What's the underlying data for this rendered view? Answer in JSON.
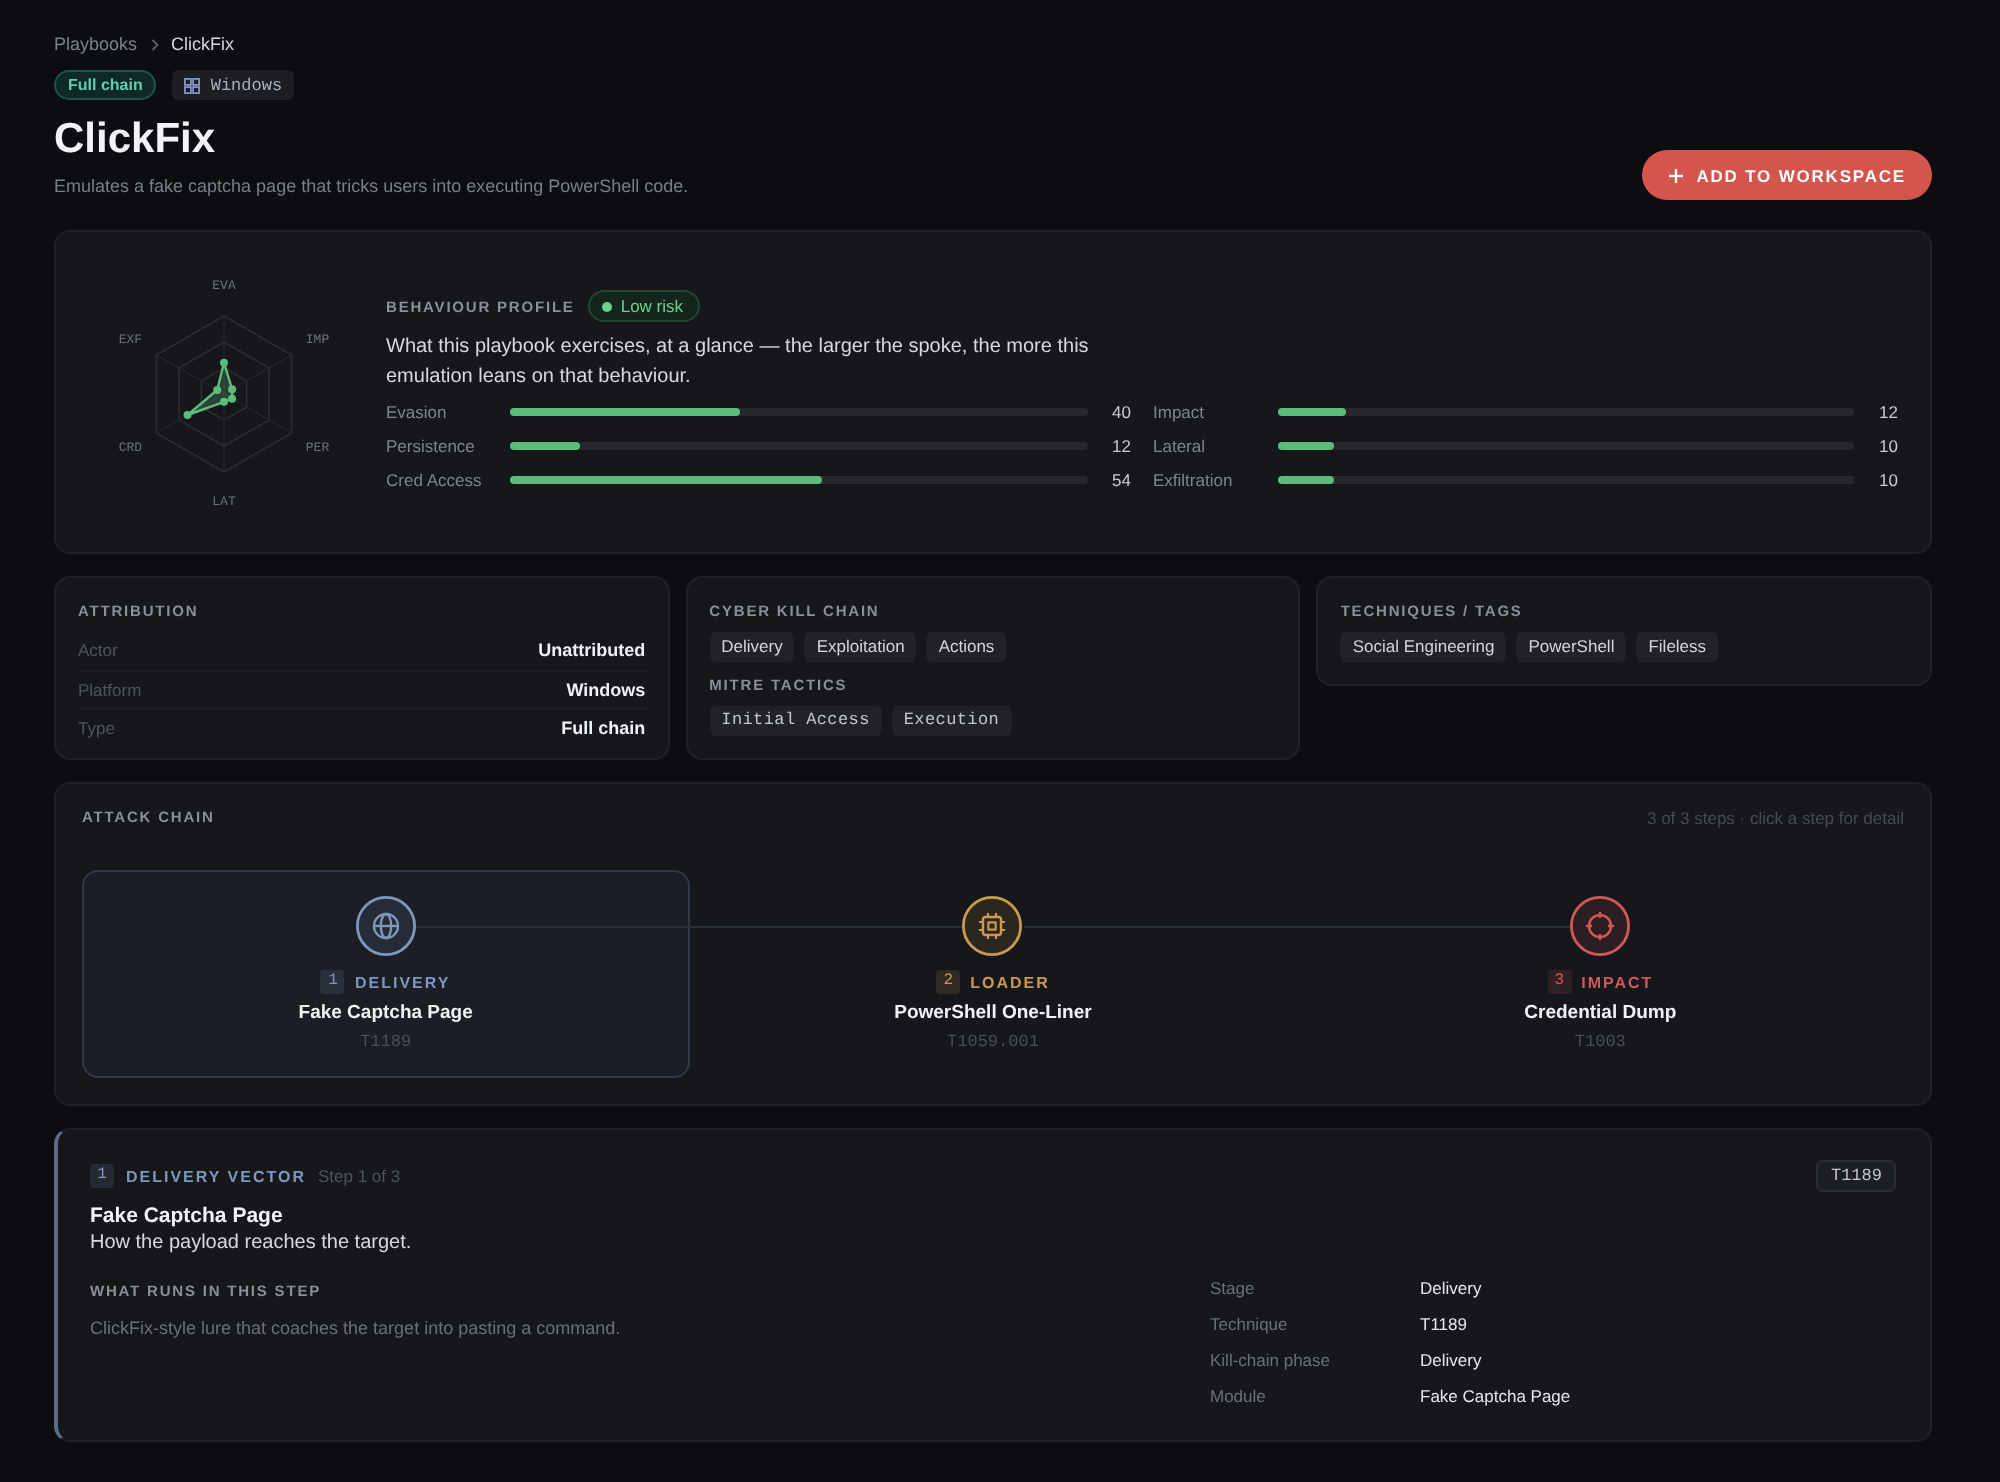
{
  "breadcrumb": [
    {
      "label": "Playbooks",
      "current": false
    },
    {
      "label": "ClickFix",
      "current": true
    }
  ],
  "tags": [
    {
      "label": "Full chain",
      "kind": "chain"
    },
    {
      "label": "Windows",
      "kind": "platform"
    }
  ],
  "title": "ClickFix",
  "subtitle": "Emulates a fake captcha page that tricks users into executing PowerShell code.",
  "action": {
    "label": "ADD TO WORKSPACE"
  },
  "behaviour": {
    "heading": "BEHAVIOUR PROFILE",
    "risk": {
      "label": "Low risk",
      "kind": "low"
    },
    "description": "What this playbook exercises, at a glance — the larger the spoke, the more this emulation leans on that behaviour.",
    "metrics": [
      {
        "name": "Evasion",
        "axis": "EVA",
        "value": "40",
        "level": 0.4
      },
      {
        "name": "Impact",
        "axis": "IMP",
        "value": "12",
        "level": 0.12
      },
      {
        "name": "Persistence",
        "axis": "PER",
        "value": "12",
        "level": 0.12
      },
      {
        "name": "Lateral",
        "axis": "LAT",
        "value": "10",
        "level": 0.1
      },
      {
        "name": "Cred Access",
        "axis": "CRD",
        "value": "54",
        "level": 0.54
      },
      {
        "name": "Exfiltration",
        "axis": "EXF",
        "value": "10",
        "level": 0.1
      }
    ]
  },
  "attribution": {
    "heading": "ATTRIBUTION",
    "rows": [
      {
        "label": "Actor",
        "value": "Unattributed"
      },
      {
        "label": "Platform",
        "value": "Windows"
      },
      {
        "label": "Type",
        "value": "Full chain"
      }
    ]
  },
  "kill_chain": {
    "heading": "CYBER KILL CHAIN",
    "phases": [
      "Delivery",
      "Exploitation",
      "Actions"
    ],
    "tactics_heading": "MITRE TACTICS",
    "tactics": [
      "Initial Access",
      "Execution"
    ]
  },
  "techniques": {
    "heading": "TECHNIQUES / TAGS",
    "tags": [
      "Social Engineering",
      "PowerShell",
      "Fileless"
    ]
  },
  "attack_chain": {
    "heading": "ATTACK CHAIN",
    "hint": "3 of 3 steps · click a step for detail",
    "steps": [
      {
        "number": "1",
        "stage": "DELIVERY",
        "title": "Fake Captcha Page",
        "code": "T1189",
        "kind": "delivery",
        "color": "#7d97bd",
        "selected": true
      },
      {
        "number": "2",
        "stage": "LOADER",
        "title": "PowerShell One-Liner",
        "code": "T1059.001",
        "kind": "loader",
        "color": "#c99a4e",
        "selected": false
      },
      {
        "number": "3",
        "stage": "IMPACT",
        "title": "Credential Dump",
        "code": "T1003",
        "kind": "impact",
        "color": "#d0585a",
        "selected": false
      }
    ]
  },
  "detail": {
    "number": "1",
    "heading": "DELIVERY VECTOR",
    "step_label": "Step 1 of 3",
    "code": "T1189",
    "title": "Fake Captcha Page",
    "summary": "How the payload reaches the target.",
    "section_heading": "WHAT RUNS IN THIS STEP",
    "body": "ClickFix-style lure that coaches the target into pasting a command.",
    "facts": [
      {
        "label": "Stage",
        "value": "Delivery"
      },
      {
        "label": "Technique",
        "value": "T1189"
      },
      {
        "label": "Kill-chain phase",
        "value": "Delivery"
      },
      {
        "label": "Module",
        "value": "Fake Captcha Page"
      }
    ]
  }
}
